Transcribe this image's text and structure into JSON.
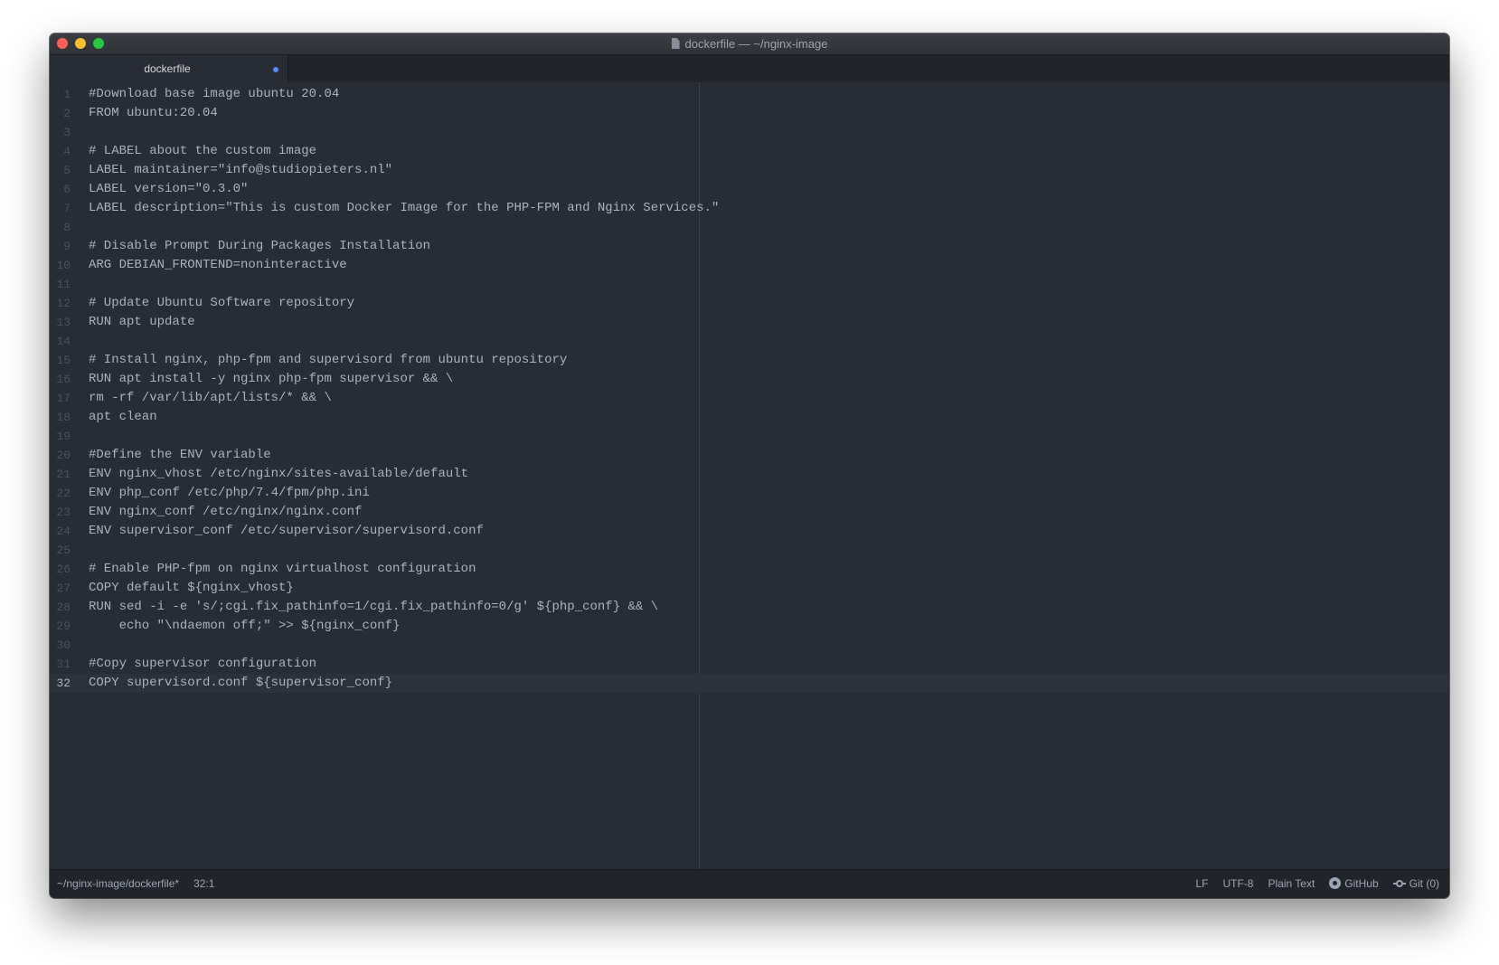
{
  "window": {
    "title": "dockerfile — ~/nginx-image"
  },
  "tabs": [
    {
      "label": "dockerfile",
      "modified": true
    }
  ],
  "editor": {
    "cursor_line": 32,
    "lines": [
      "#Download base image ubuntu 20.04",
      "FROM ubuntu:20.04",
      "",
      "# LABEL about the custom image",
      "LABEL maintainer=\"info@studiopieters.nl\"",
      "LABEL version=\"0.3.0\"",
      "LABEL description=\"This is custom Docker Image for the PHP-FPM and Nginx Services.\"",
      "",
      "# Disable Prompt During Packages Installation",
      "ARG DEBIAN_FRONTEND=noninteractive",
      "",
      "# Update Ubuntu Software repository",
      "RUN apt update",
      "",
      "# Install nginx, php-fpm and supervisord from ubuntu repository",
      "RUN apt install -y nginx php-fpm supervisor && \\",
      "rm -rf /var/lib/apt/lists/* && \\",
      "apt clean",
      "",
      "#Define the ENV variable",
      "ENV nginx_vhost /etc/nginx/sites-available/default",
      "ENV php_conf /etc/php/7.4/fpm/php.ini",
      "ENV nginx_conf /etc/nginx/nginx.conf",
      "ENV supervisor_conf /etc/supervisor/supervisord.conf",
      "",
      "# Enable PHP-fpm on nginx virtualhost configuration",
      "COPY default ${nginx_vhost}",
      "RUN sed -i -e 's/;cgi.fix_pathinfo=1/cgi.fix_pathinfo=0/g' ${php_conf} && \\",
      "    echo \"\\ndaemon off;\" >> ${nginx_conf}",
      "",
      "#Copy supervisor configuration",
      "COPY supervisord.conf ${supervisor_conf}"
    ]
  },
  "status_bar": {
    "file_path": "~/nginx-image/dockerfile*",
    "cursor_position": "32:1",
    "line_ending": "LF",
    "encoding": "UTF-8",
    "grammar": "Plain Text",
    "github_label": "GitHub",
    "git_label": "Git (0)"
  },
  "icons": {
    "file": "file-icon",
    "github": "github-icon",
    "git": "git-commit-icon"
  },
  "colors": {
    "background": "#282c34",
    "text": "#abb2bf",
    "modified_dot": "#568af2",
    "close": "#fe5f57",
    "minimize": "#febc2e",
    "maximize": "#28c840"
  }
}
